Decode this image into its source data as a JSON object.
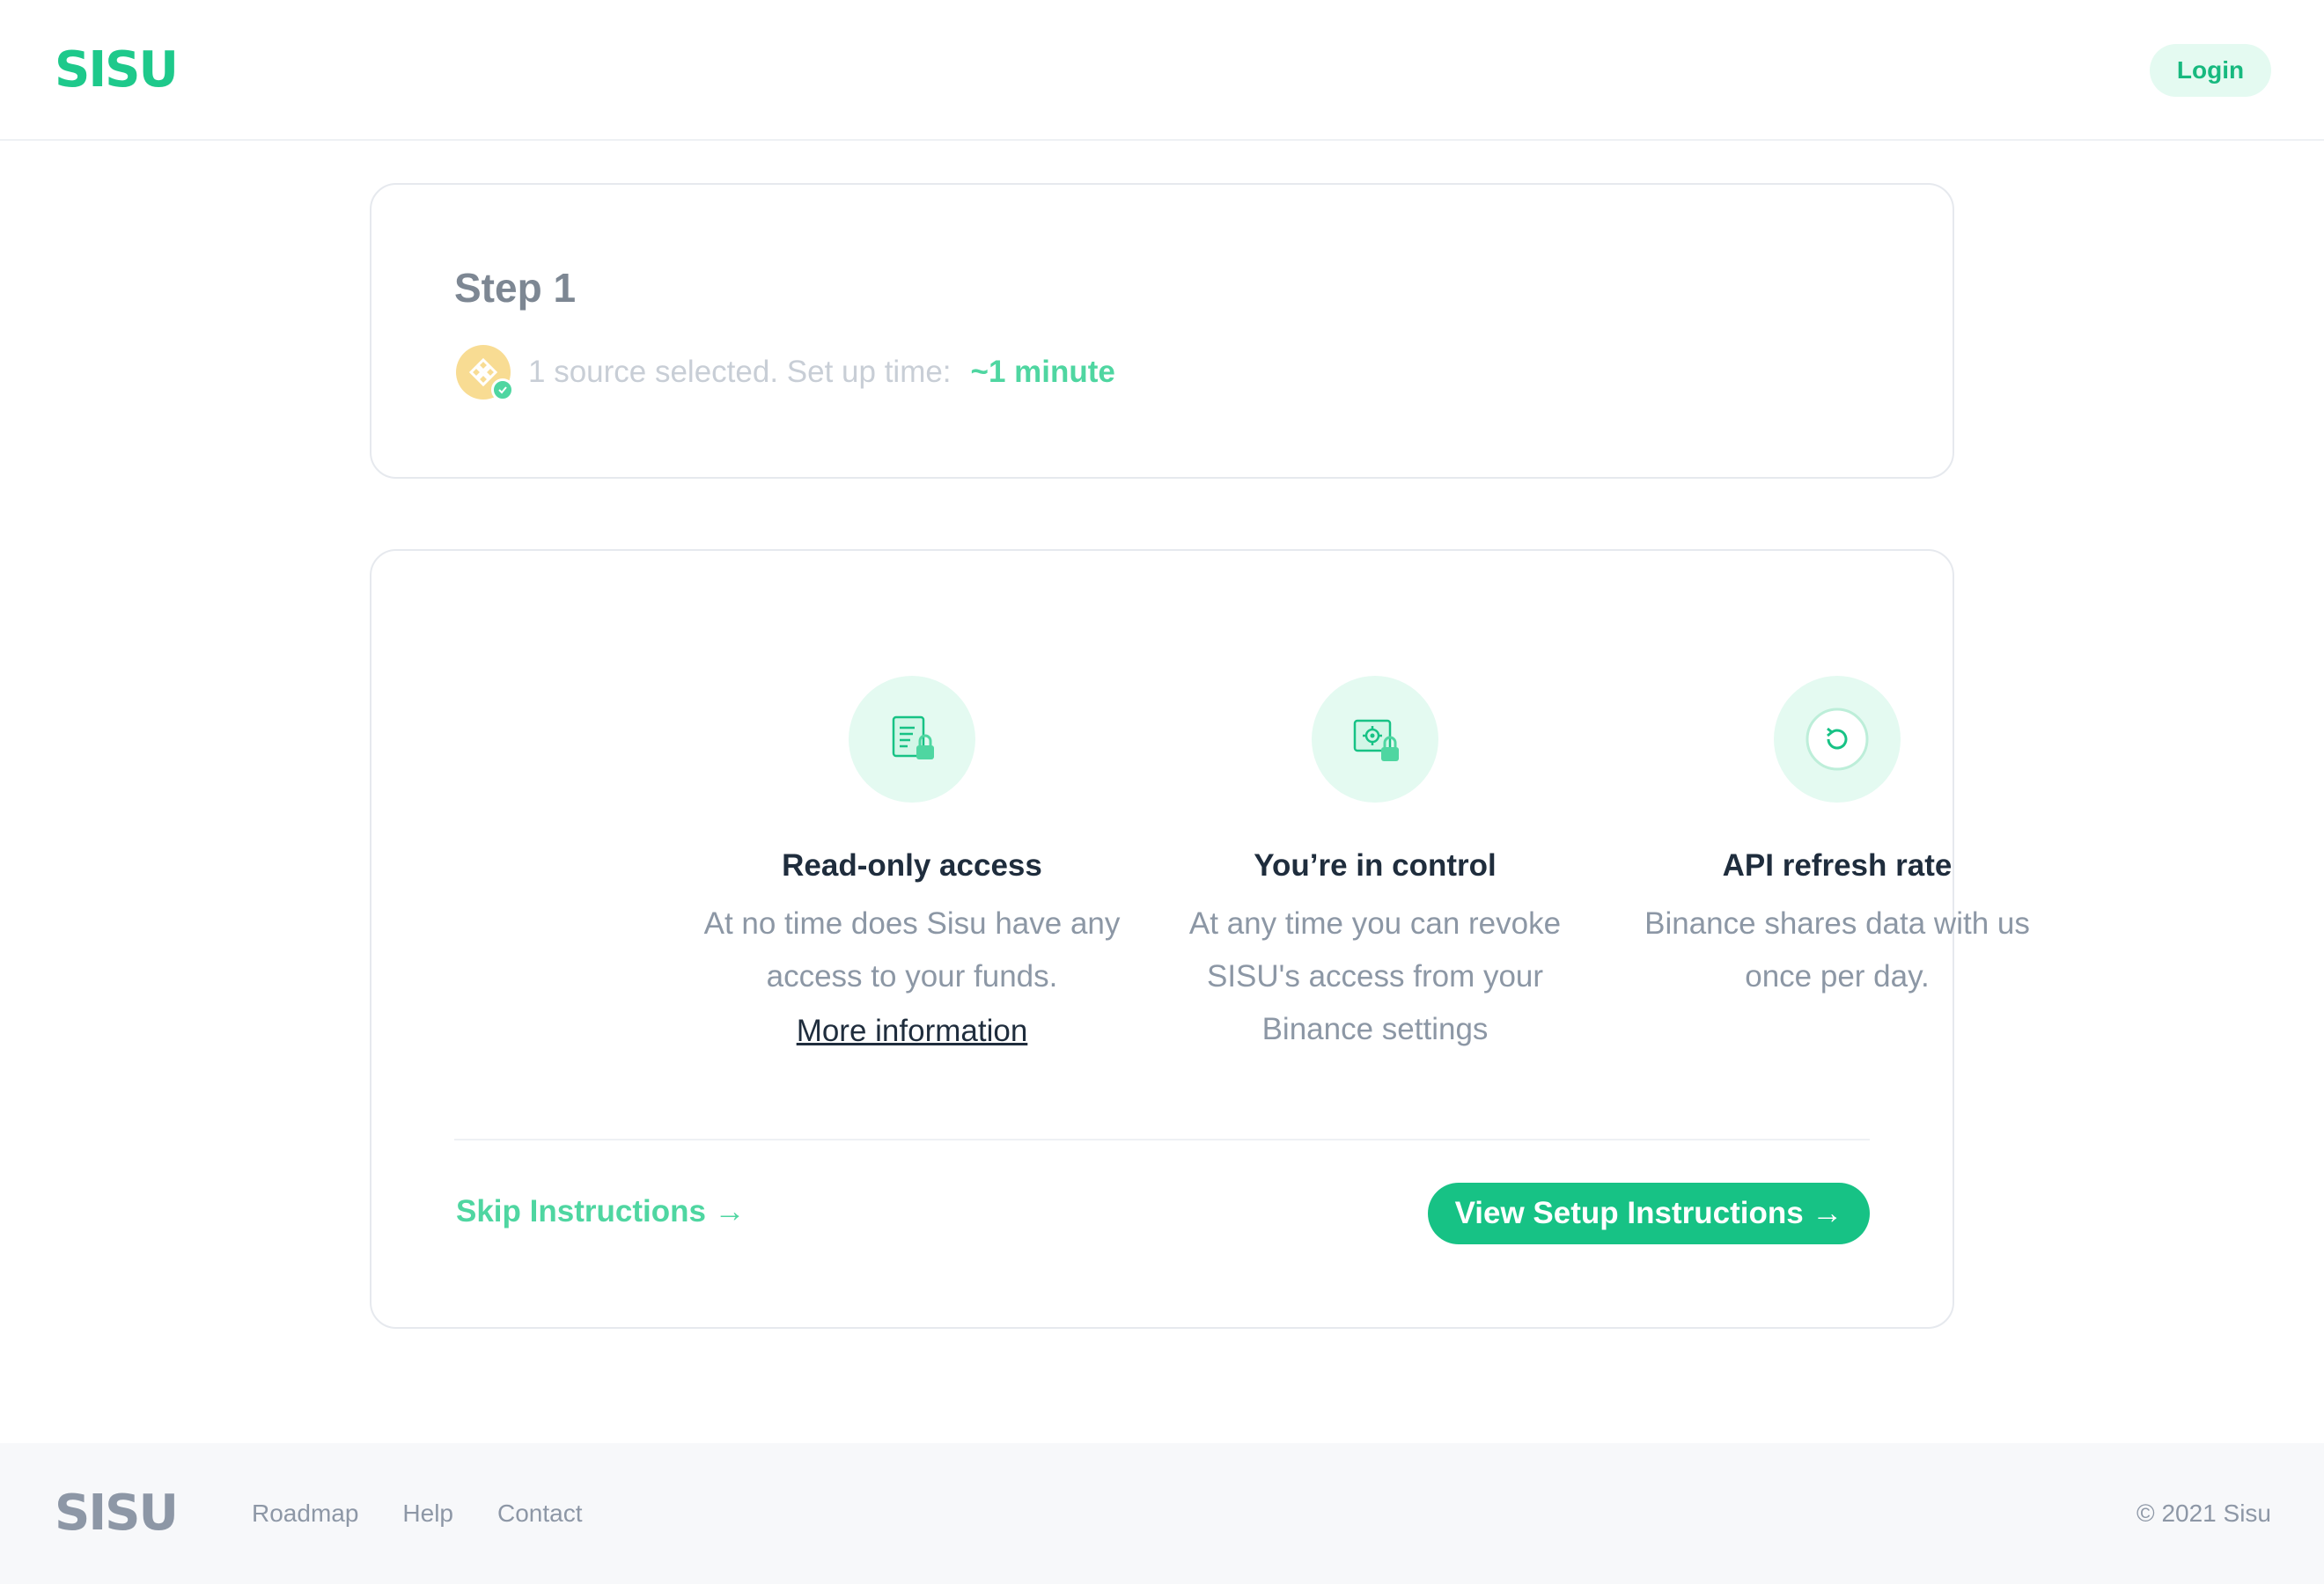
{
  "header": {
    "logo": "SISU",
    "login_label": "Login"
  },
  "step": {
    "title": "Step 1",
    "source_text": "1 source selected. Set up time:",
    "setup_time": "~1 minute",
    "source_icon": "binance-coin-icon"
  },
  "features": [
    {
      "icon": "document-lock-icon",
      "title": "Read-only access",
      "description": "At no time does Sisu have any access to your funds.",
      "link": "More information"
    },
    {
      "icon": "settings-lock-icon",
      "title": "You’re in control",
      "description": "At any time you can revoke SISU's access from your Binance settings"
    },
    {
      "icon": "refresh-icon",
      "title": "API refresh rate",
      "description": "Binance shares data with us once per day."
    }
  ],
  "actions": {
    "skip_label": "Skip Instructions →",
    "view_label": "View Setup Instructions →"
  },
  "footer": {
    "logo": "SISU",
    "links": [
      "Roadmap",
      "Help",
      "Contact"
    ],
    "copyright": "© 2021 Sisu"
  },
  "colors": {
    "brand": "#1ec98b",
    "accent_button": "#17c285",
    "light_green": "#e4faf1",
    "muted_text": "#8c97a5"
  }
}
